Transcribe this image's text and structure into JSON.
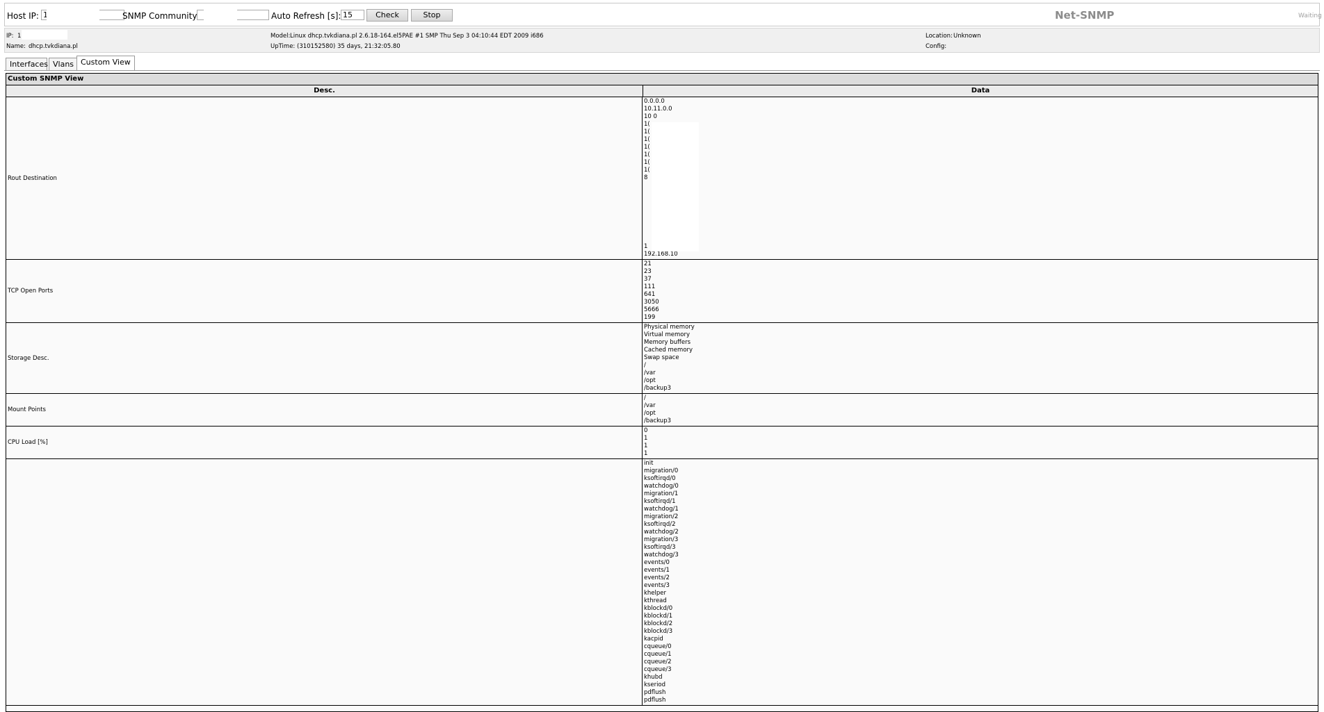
{
  "toolbar": {
    "host_ip_label": "Host IP:",
    "host_ip_value": "1",
    "community_label": "SNMP Community:",
    "community_value": "",
    "refresh_label": "Auto Refresh [s]:",
    "refresh_value": "15",
    "check_label": "Check",
    "stop_label": "Stop",
    "app_title": "Net-SNMP",
    "status": "Waiting"
  },
  "info": {
    "ip_label": "IP:",
    "ip_value": "1",
    "name_label": "Name:",
    "name_value": "dhcp.tvkdiana.pl",
    "model_label": "Model:",
    "model_value": "Linux dhcp.tvkdiana.pl 2.6.18-164.el5PAE #1 SMP Thu Sep 3 04:10:44 EDT 2009 i686",
    "uptime_label": "UpTime:",
    "uptime_value": "(310152580) 35 days, 21:32:05.80",
    "location_label": "Location:",
    "location_value": "Unknown",
    "config_label": "Config:",
    "config_value": ""
  },
  "tabs": [
    {
      "label": "Interfaces"
    },
    {
      "label": "Vlans"
    },
    {
      "label": "Custom View"
    }
  ],
  "view": {
    "title": "Custom SNMP View",
    "col_desc": "Desc.",
    "col_data": "Data",
    "rows": [
      {
        "desc": "Rout Destination",
        "values": [
          "0.0.0.0",
          "10.11.0.0",
          "10          0",
          "1(",
          "1(",
          "1(",
          "1(",
          "1(",
          "1(",
          "1(",
          "8",
          "",
          "",
          "",
          "",
          "",
          "",
          "",
          "",
          "1",
          "192.168.10"
        ]
      },
      {
        "desc": "TCP Open Ports",
        "values": [
          "21",
          "23",
          "37",
          "111",
          "641",
          "3050",
          "5666",
          "199"
        ]
      },
      {
        "desc": "Storage Desc.",
        "values": [
          "Physical memory",
          "Virtual memory",
          "Memory buffers",
          "Cached memory",
          "Swap space",
          "/",
          "/var",
          "/opt",
          "/backup3"
        ]
      },
      {
        "desc": "Mount Points",
        "values": [
          "/",
          "/var",
          "/opt",
          "/backup3"
        ]
      },
      {
        "desc": "CPU Load [%]",
        "values": [
          "0",
          "1",
          "1",
          "1"
        ]
      },
      {
        "desc": "",
        "values": [
          "init",
          "migration/0",
          "ksoftirqd/0",
          "watchdog/0",
          "migration/1",
          "ksoftirqd/1",
          "watchdog/1",
          "migration/2",
          "ksoftirqd/2",
          "watchdog/2",
          "migration/3",
          "ksoftirqd/3",
          "watchdog/3",
          "events/0",
          "events/1",
          "events/2",
          "events/3",
          "khelper",
          "kthread",
          "kblockd/0",
          "kblockd/1",
          "kblockd/2",
          "kblockd/3",
          "kacpid",
          "cqueue/0",
          "cqueue/1",
          "cqueue/2",
          "cqueue/3",
          "khubd",
          "kseriod",
          "pdflush",
          "pdflush"
        ]
      }
    ]
  }
}
